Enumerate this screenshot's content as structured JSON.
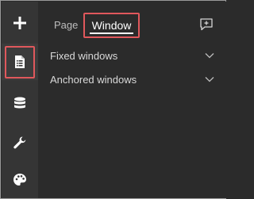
{
  "rail": {
    "items": [
      {
        "name": "add",
        "icon": "plus-icon"
      },
      {
        "name": "page",
        "icon": "page-icon",
        "selected": true
      },
      {
        "name": "data",
        "icon": "database-icon"
      },
      {
        "name": "widget-settings",
        "icon": "wrench-icon"
      },
      {
        "name": "theme",
        "icon": "palette-icon"
      }
    ]
  },
  "tabs": [
    {
      "label": "Page",
      "active": false
    },
    {
      "label": "Window",
      "active": true
    }
  ],
  "toolbar": {
    "add_page_icon": "add-page-icon"
  },
  "sections": [
    {
      "label": "Fixed windows"
    },
    {
      "label": "Anchored windows"
    }
  ],
  "colors": {
    "background": "#2b2b2b",
    "rail": "#353535",
    "highlight_outline": "#e0585c",
    "text": "#d9d9d9"
  }
}
